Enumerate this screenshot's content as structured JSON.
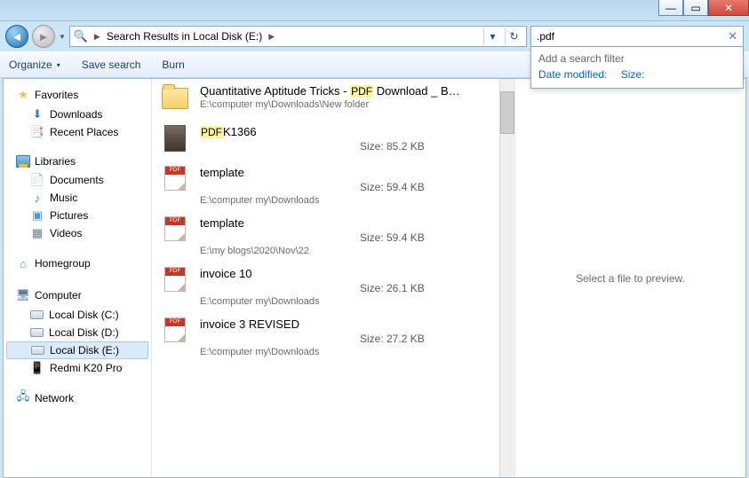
{
  "titlebar": {
    "min": "—",
    "max": "▭",
    "close": "✕"
  },
  "nav": {
    "address_icon": "🔍",
    "address_text": "Search Results in Local Disk (E:)",
    "search_value": ".pdf",
    "search_hint": "Add a search filter",
    "filter_date": "Date modified:",
    "filter_size": "Size:"
  },
  "toolbar": {
    "organize": "Organize",
    "save": "Save search",
    "burn": "Burn"
  },
  "navpane": {
    "favorites": "Favorites",
    "downloads": "Downloads",
    "recent": "Recent Places",
    "libraries": "Libraries",
    "documents": "Documents",
    "music": "Music",
    "pictures": "Pictures",
    "videos": "Videos",
    "homegroup": "Homegroup",
    "computer": "Computer",
    "drive_c": "Local Disk (C:)",
    "drive_d": "Local Disk (D:)",
    "drive_e": "Local Disk (E:)",
    "redmi": "Redmi K20 Pro",
    "network": "Network"
  },
  "results": [
    {
      "type": "folder",
      "title_pre": "Quantitative Aptitude Tricks - ",
      "title_hl": "PDF",
      "title_post": " Download _ B…",
      "sub": "E:\\computer my\\Downloads\\New folder",
      "size": ""
    },
    {
      "type": "img",
      "title_pre": "",
      "title_hl": "PDF",
      "title_post": "K1366",
      "sub": "",
      "size": "Size: 85.2 KB"
    },
    {
      "type": "pdf",
      "title_pre": "template",
      "title_hl": "",
      "title_post": "",
      "sub": "E:\\computer my\\Downloads",
      "size": "Size: 59.4 KB"
    },
    {
      "type": "pdf",
      "title_pre": "template",
      "title_hl": "",
      "title_post": "",
      "sub": "E:\\my blogs\\2020\\Nov\\22",
      "size": "Size: 59.4 KB"
    },
    {
      "type": "pdf",
      "title_pre": "invoice 10",
      "title_hl": "",
      "title_post": "",
      "sub": "E:\\computer my\\Downloads",
      "size": "Size: 26.1 KB"
    },
    {
      "type": "pdf",
      "title_pre": "invoice 3 REVISED",
      "title_hl": "",
      "title_post": "",
      "sub": "E:\\computer my\\Downloads",
      "size": "Size: 27.2 KB"
    }
  ],
  "preview": {
    "placeholder": "Select a file to preview."
  }
}
